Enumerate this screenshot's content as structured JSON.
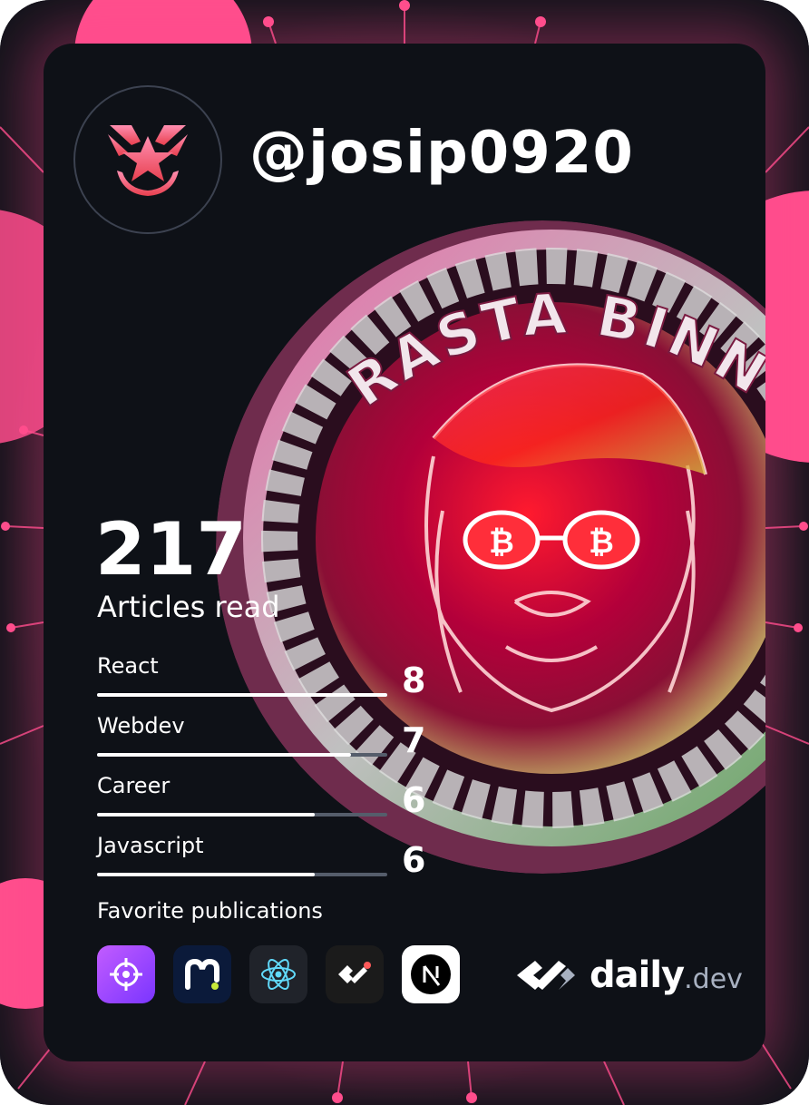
{
  "profile": {
    "username": "@josip0920"
  },
  "stats": {
    "articles_read": "217",
    "articles_label": "Articles read"
  },
  "tags": [
    {
      "name": "React",
      "count": "8",
      "fill_fraction": 1.0
    },
    {
      "name": "Webdev",
      "count": "7",
      "fill_fraction": 0.875
    },
    {
      "name": "Career",
      "count": "6",
      "fill_fraction": 0.75
    },
    {
      "name": "Javascript",
      "count": "6",
      "fill_fraction": 0.75
    }
  ],
  "favorites": {
    "label": "Favorite publications",
    "publications": [
      {
        "icon": "crosshair-icon",
        "bg": "#a84bff"
      },
      {
        "icon": "m-logo-icon",
        "bg": "#0b1a3a"
      },
      {
        "icon": "react-atom-icon",
        "bg": "#20232a"
      },
      {
        "icon": "daily-dev-icon",
        "bg": "#1b1b1b"
      },
      {
        "icon": "nextjs-icon",
        "bg": "#ffffff"
      }
    ]
  },
  "brand": {
    "daily": "daily",
    "dev": ".dev"
  },
  "cover": {
    "text": "RASTA BINNA",
    "glasses_symbol": "₿"
  },
  "colors": {
    "accent": "#ff4f8d",
    "card_bg": "#0e1117",
    "frame_bg": "#0d1016"
  }
}
